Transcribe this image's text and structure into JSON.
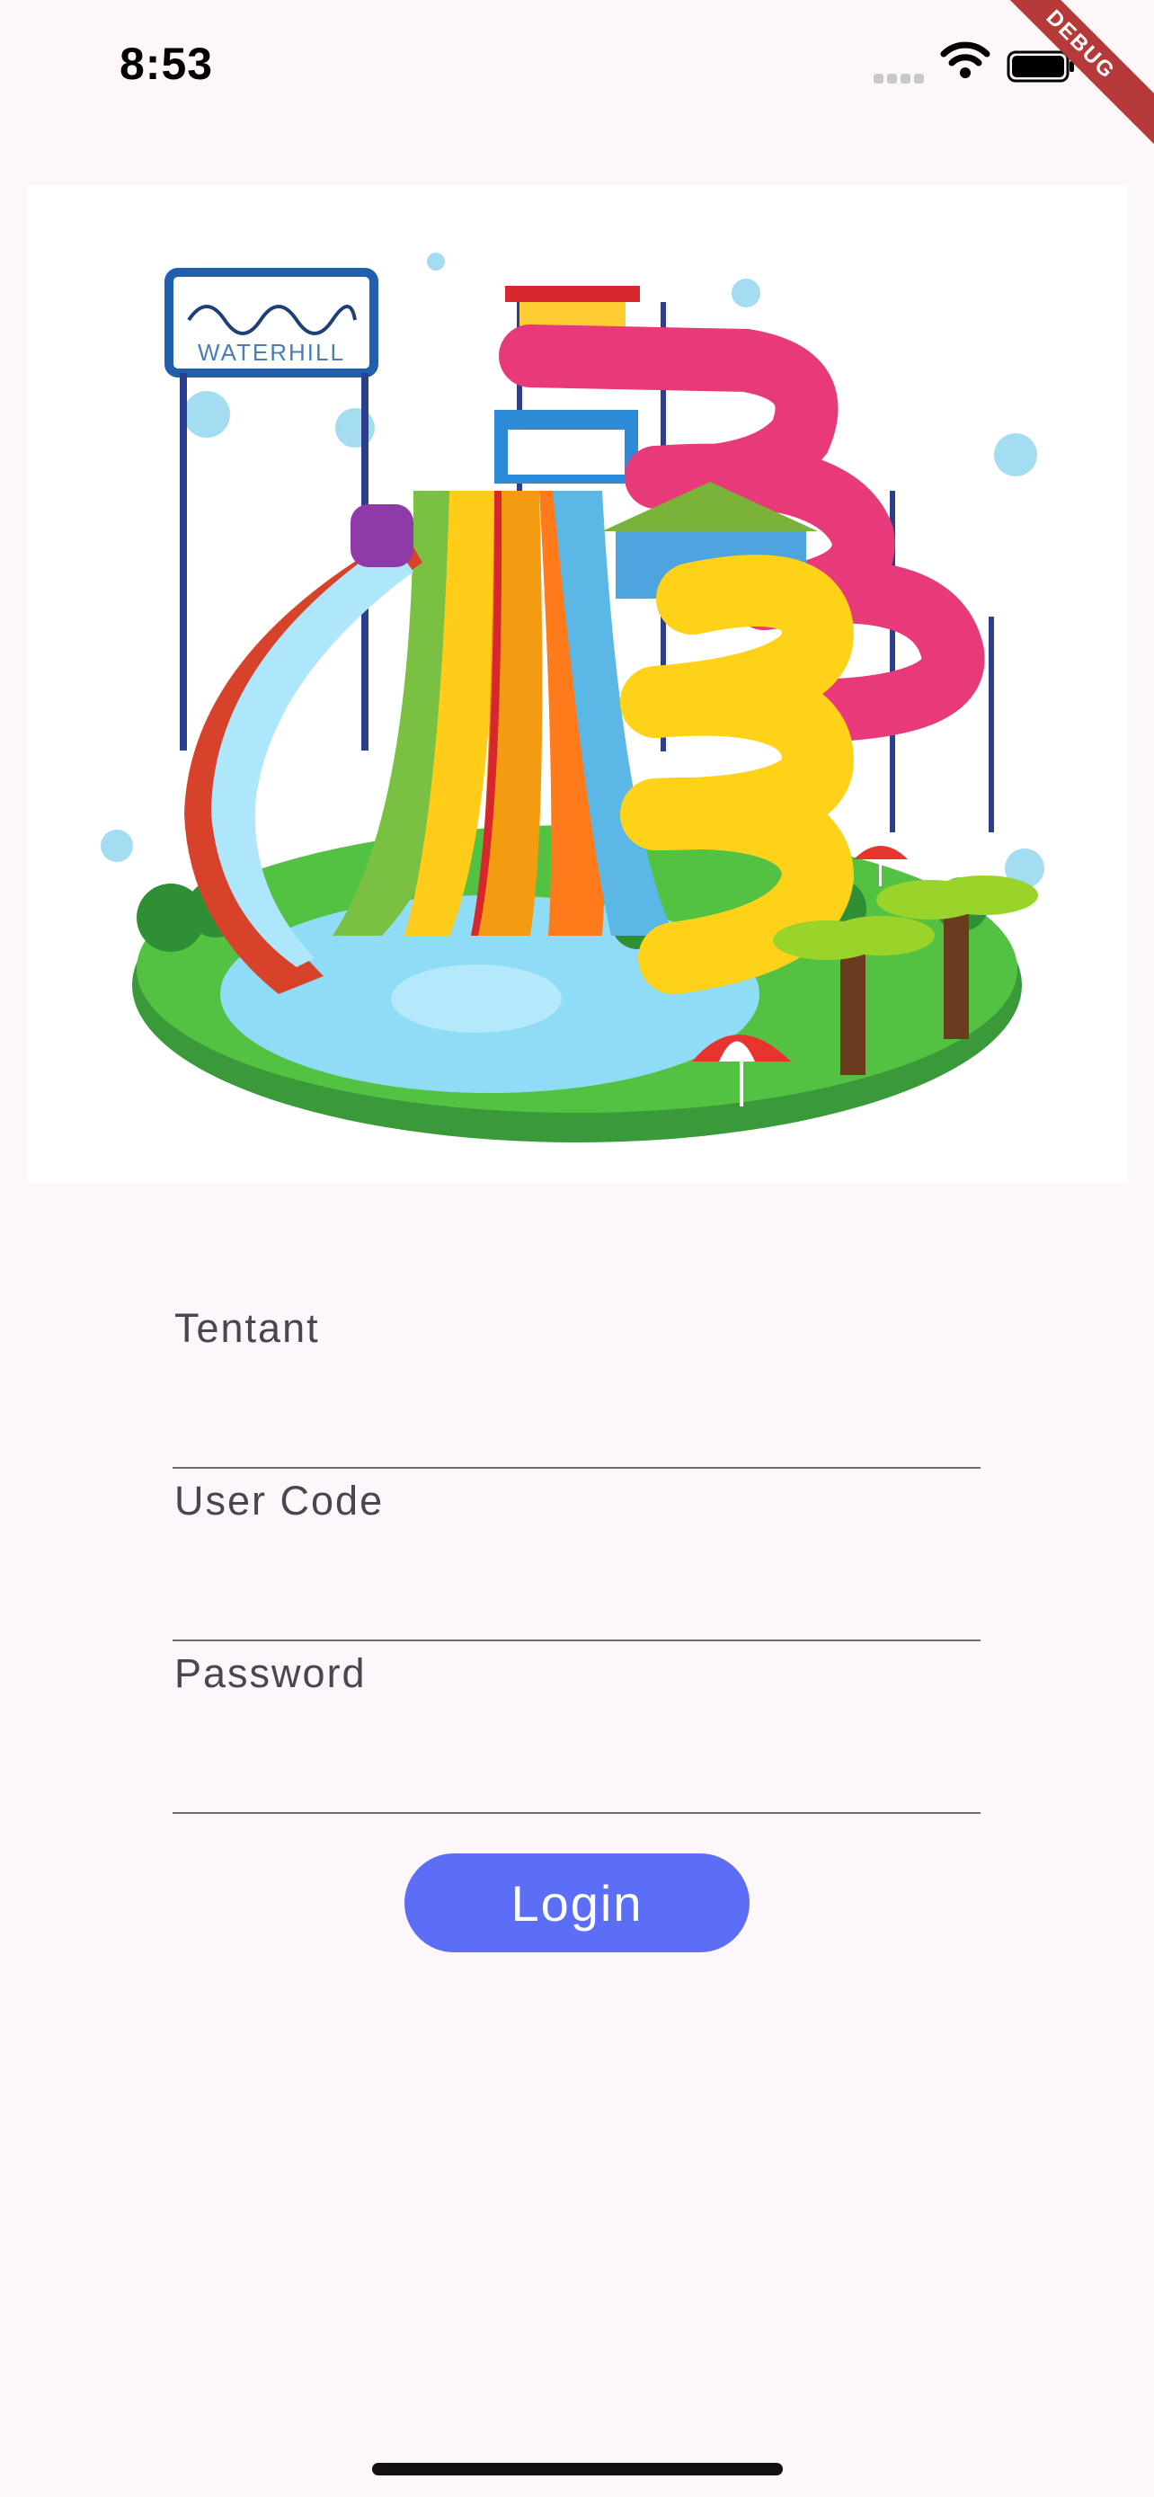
{
  "status_bar": {
    "time": "8:53",
    "icons": [
      "signal-icon",
      "wifi-icon",
      "battery-icon"
    ]
  },
  "debug_banner": {
    "label": "DEBUG",
    "color": "#b73a3a"
  },
  "hero_image": {
    "sign_text": "WATERHILL"
  },
  "form": {
    "fields": [
      {
        "label": "Tentant",
        "value": ""
      },
      {
        "label": "User Code",
        "value": ""
      },
      {
        "label": "Password",
        "value": ""
      }
    ],
    "login_label": "Login"
  },
  "colors": {
    "background": "#fdf7fb",
    "accent": "#5b6ef5",
    "underline": "#6f6a70"
  }
}
